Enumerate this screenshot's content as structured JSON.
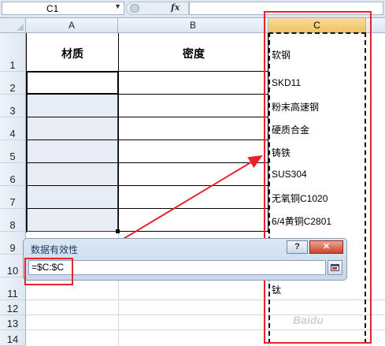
{
  "formula_bar": {
    "name_box": "C1",
    "name_box_arrow": "▼",
    "fx_label": "fx",
    "formula": ""
  },
  "columns": [
    "A",
    "B",
    "C"
  ],
  "rows": [
    "1",
    "2",
    "3",
    "4",
    "5",
    "6",
    "7",
    "8",
    "9",
    "10",
    "11",
    "12",
    "13",
    "14"
  ],
  "header_cells": {
    "a1": "材质",
    "b1": "密度"
  },
  "column_c_values": [
    "软钢",
    "SKD11",
    "粉末高速钢",
    "硬质合金",
    "铸铁",
    "SUS304",
    "无氧铜C1020",
    "6/4黄铜C2801",
    "",
    "",
    "钛"
  ],
  "dialog": {
    "title": "数据有效性",
    "help_label": "?",
    "close_label": "✕",
    "range_value": "=$C:$C",
    "collapse_icon": "collapse-dialog-icon"
  },
  "colors": {
    "annotation_red": "#e8242b",
    "selected_header": "#f1c15f",
    "header_bg": "#dde6f1"
  },
  "watermark": "Baidu"
}
